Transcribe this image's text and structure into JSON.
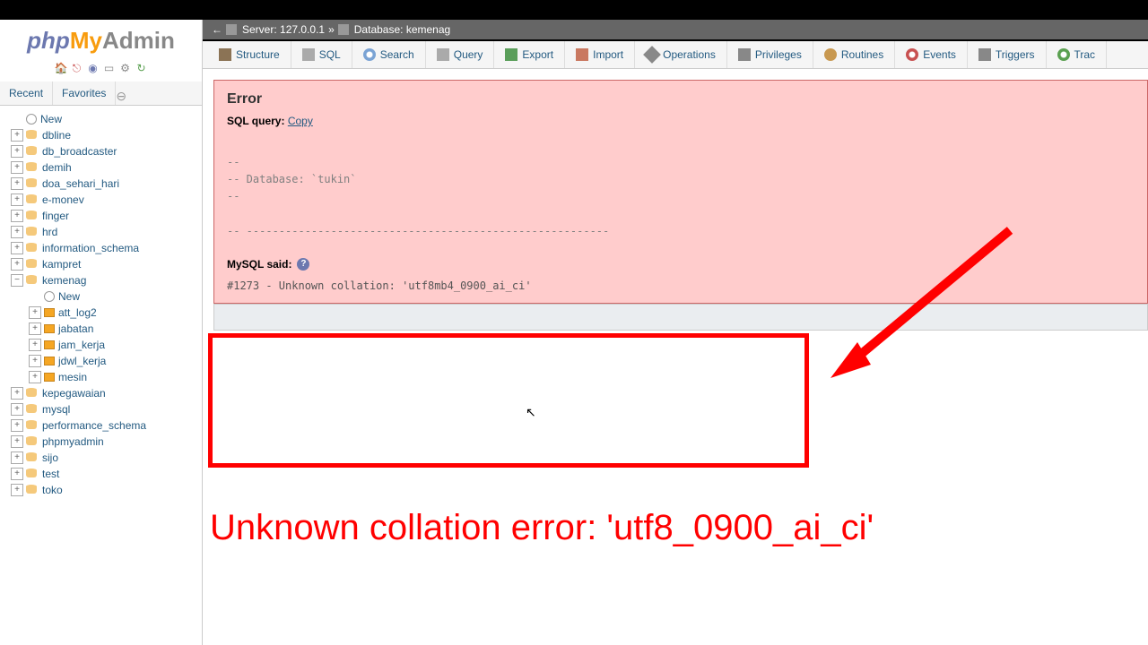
{
  "logo": {
    "php": "php",
    "my": "My",
    "admin": "Admin"
  },
  "nav": {
    "recent": "Recent",
    "favorites": "Favorites"
  },
  "tree": {
    "new": "New",
    "databases": [
      "dbline",
      "db_broadcaster",
      "demih",
      "doa_sehari_hari",
      "e-monev",
      "finger",
      "hrd",
      "information_schema",
      "kampret"
    ],
    "expanded_db": "kemenag",
    "expanded_new": "New",
    "tables": [
      "att_log2",
      "jabatan",
      "jam_kerja",
      "jdwl_kerja",
      "mesin"
    ],
    "databases2": [
      "kepegawaian",
      "mysql",
      "performance_schema",
      "phpmyadmin",
      "sijo",
      "test",
      "toko"
    ]
  },
  "breadcrumb": {
    "server_label": "Server:",
    "server_value": "127.0.0.1",
    "sep": "»",
    "db_label": "Database:",
    "db_value": "kemenag",
    "left_arrow": "←"
  },
  "tabs": {
    "structure": "Structure",
    "sql": "SQL",
    "search": "Search",
    "query": "Query",
    "export": "Export",
    "import": "Import",
    "operations": "Operations",
    "privileges": "Privileges",
    "routines": "Routines",
    "events": "Events",
    "triggers": "Triggers",
    "track": "Trac"
  },
  "error": {
    "title": "Error",
    "sql_query_label": "SQL query:",
    "copy": "Copy",
    "sql_line1": "--",
    "sql_line2": "-- Database: `tukin`",
    "sql_line3": "--",
    "sql_line4": "-- --------------------------------------------------------",
    "mysql_said": "MySQL said:",
    "help": "?",
    "error_text": "#1273 - Unknown collation: 'utf8mb4_0900_ai_ci'"
  },
  "annotation": "Unknown collation error: 'utf8_0900_ai_ci'"
}
